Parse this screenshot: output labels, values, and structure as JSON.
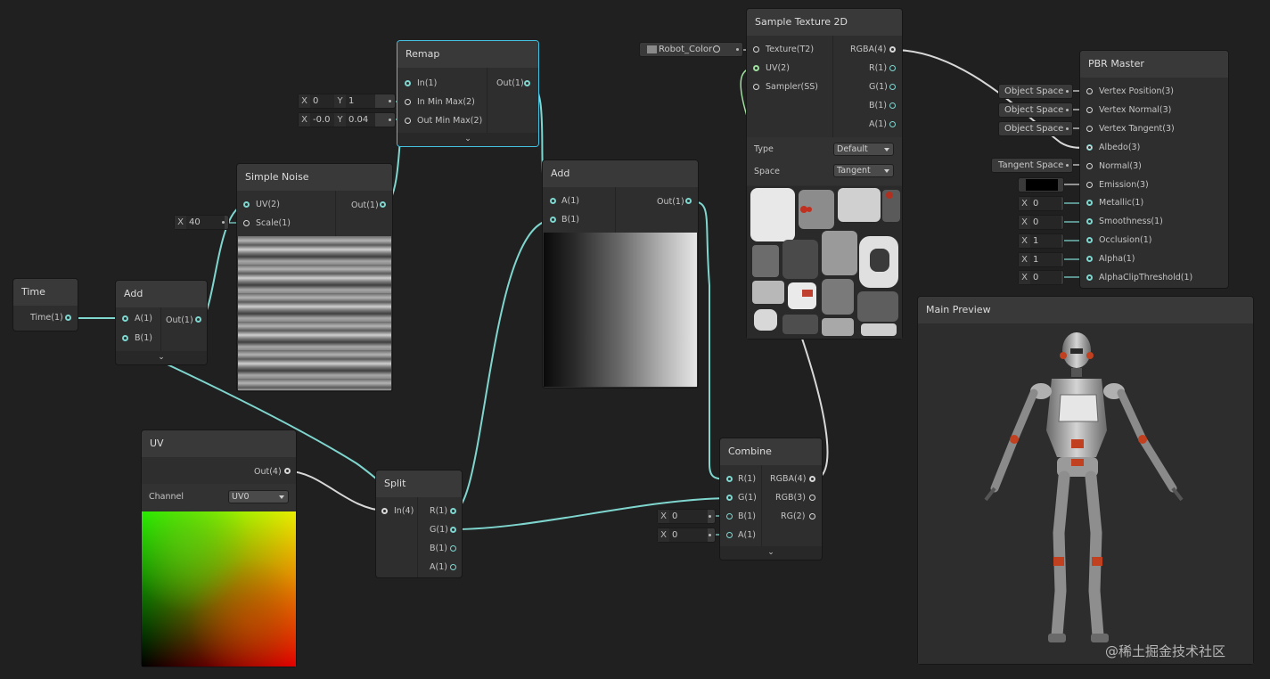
{
  "colors": {
    "background": "#202020",
    "node": "#2e2e2e",
    "wire_color": "#7fd6cf",
    "wire_white": "#d8d8d8",
    "selection": "#44c0e0"
  },
  "chevron_icon": "chevron-down-icon",
  "time": {
    "title": "Time",
    "out": "Time(1)"
  },
  "add1": {
    "title": "Add",
    "in_a": "A(1)",
    "in_b": "B(1)",
    "out": "Out(1)"
  },
  "noise": {
    "title": "Simple Noise",
    "in_uv": "UV(2)",
    "in_scale": "Scale(1)",
    "out": "Out(1)",
    "scale_x_label": "X",
    "scale_value": "40"
  },
  "remap": {
    "title": "Remap",
    "in": "In(1)",
    "in_minmax": "In Min Max(2)",
    "out_minmax": "Out Min Max(2)",
    "out": "Out(1)",
    "in_field": {
      "x_label": "X",
      "x": "0",
      "y_label": "Y",
      "y": "1"
    },
    "out_field": {
      "x_label": "X",
      "x": "-0.0",
      "y_label": "Y",
      "y": "0.04"
    }
  },
  "add2": {
    "title": "Add",
    "in_a": "A(1)",
    "in_b": "B(1)",
    "out": "Out(1)"
  },
  "uv": {
    "title": "UV",
    "out": "Out(4)",
    "channel_label": "Channel",
    "channel_value": "UV0"
  },
  "split": {
    "title": "Split",
    "in": "In(4)",
    "out_r": "R(1)",
    "out_g": "G(1)",
    "out_b": "B(1)",
    "out_a": "A(1)"
  },
  "sample": {
    "title": "Sample Texture 2D",
    "texture_ref": "Robot_Color",
    "in_tex": "Texture(T2)",
    "in_uv": "UV(2)",
    "in_sampler": "Sampler(SS)",
    "out_rgba": "RGBA(4)",
    "out_r": "R(1)",
    "out_g": "G(1)",
    "out_b": "B(1)",
    "out_a": "A(1)",
    "type_label": "Type",
    "type_value": "Default",
    "space_label": "Space",
    "space_value": "Tangent"
  },
  "combine": {
    "title": "Combine",
    "in_r": "R(1)",
    "in_g": "G(1)",
    "in_b": "B(1)",
    "in_a": "A(1)",
    "out_rgba": "RGBA(4)",
    "out_rgb": "RGB(3)",
    "out_rg": "RG(2)",
    "b_x_label": "X",
    "b_value": "0",
    "a_x_label": "X",
    "a_value": "0"
  },
  "master": {
    "title": "PBR Master",
    "ports": [
      "Vertex Position(3)",
      "Vertex Normal(3)",
      "Vertex Tangent(3)",
      "Albedo(3)",
      "Normal(3)",
      "Emission(3)",
      "Metallic(1)",
      "Smoothness(1)",
      "Occlusion(1)",
      "Alpha(1)",
      "AlphaClipThreshold(1)"
    ],
    "fields": {
      "vertex_position": "Object Space",
      "vertex_normal": "Object Space",
      "vertex_tangent": "Object Space",
      "normal": "Tangent Space",
      "x_label": "X",
      "metallic": "0",
      "smoothness": "0",
      "occlusion": "1",
      "alpha": "1",
      "alpha_clip": "0"
    },
    "emission_color": "#000000"
  },
  "main_preview": {
    "title": "Main Preview"
  },
  "watermark": "@稀土掘金技术社区"
}
